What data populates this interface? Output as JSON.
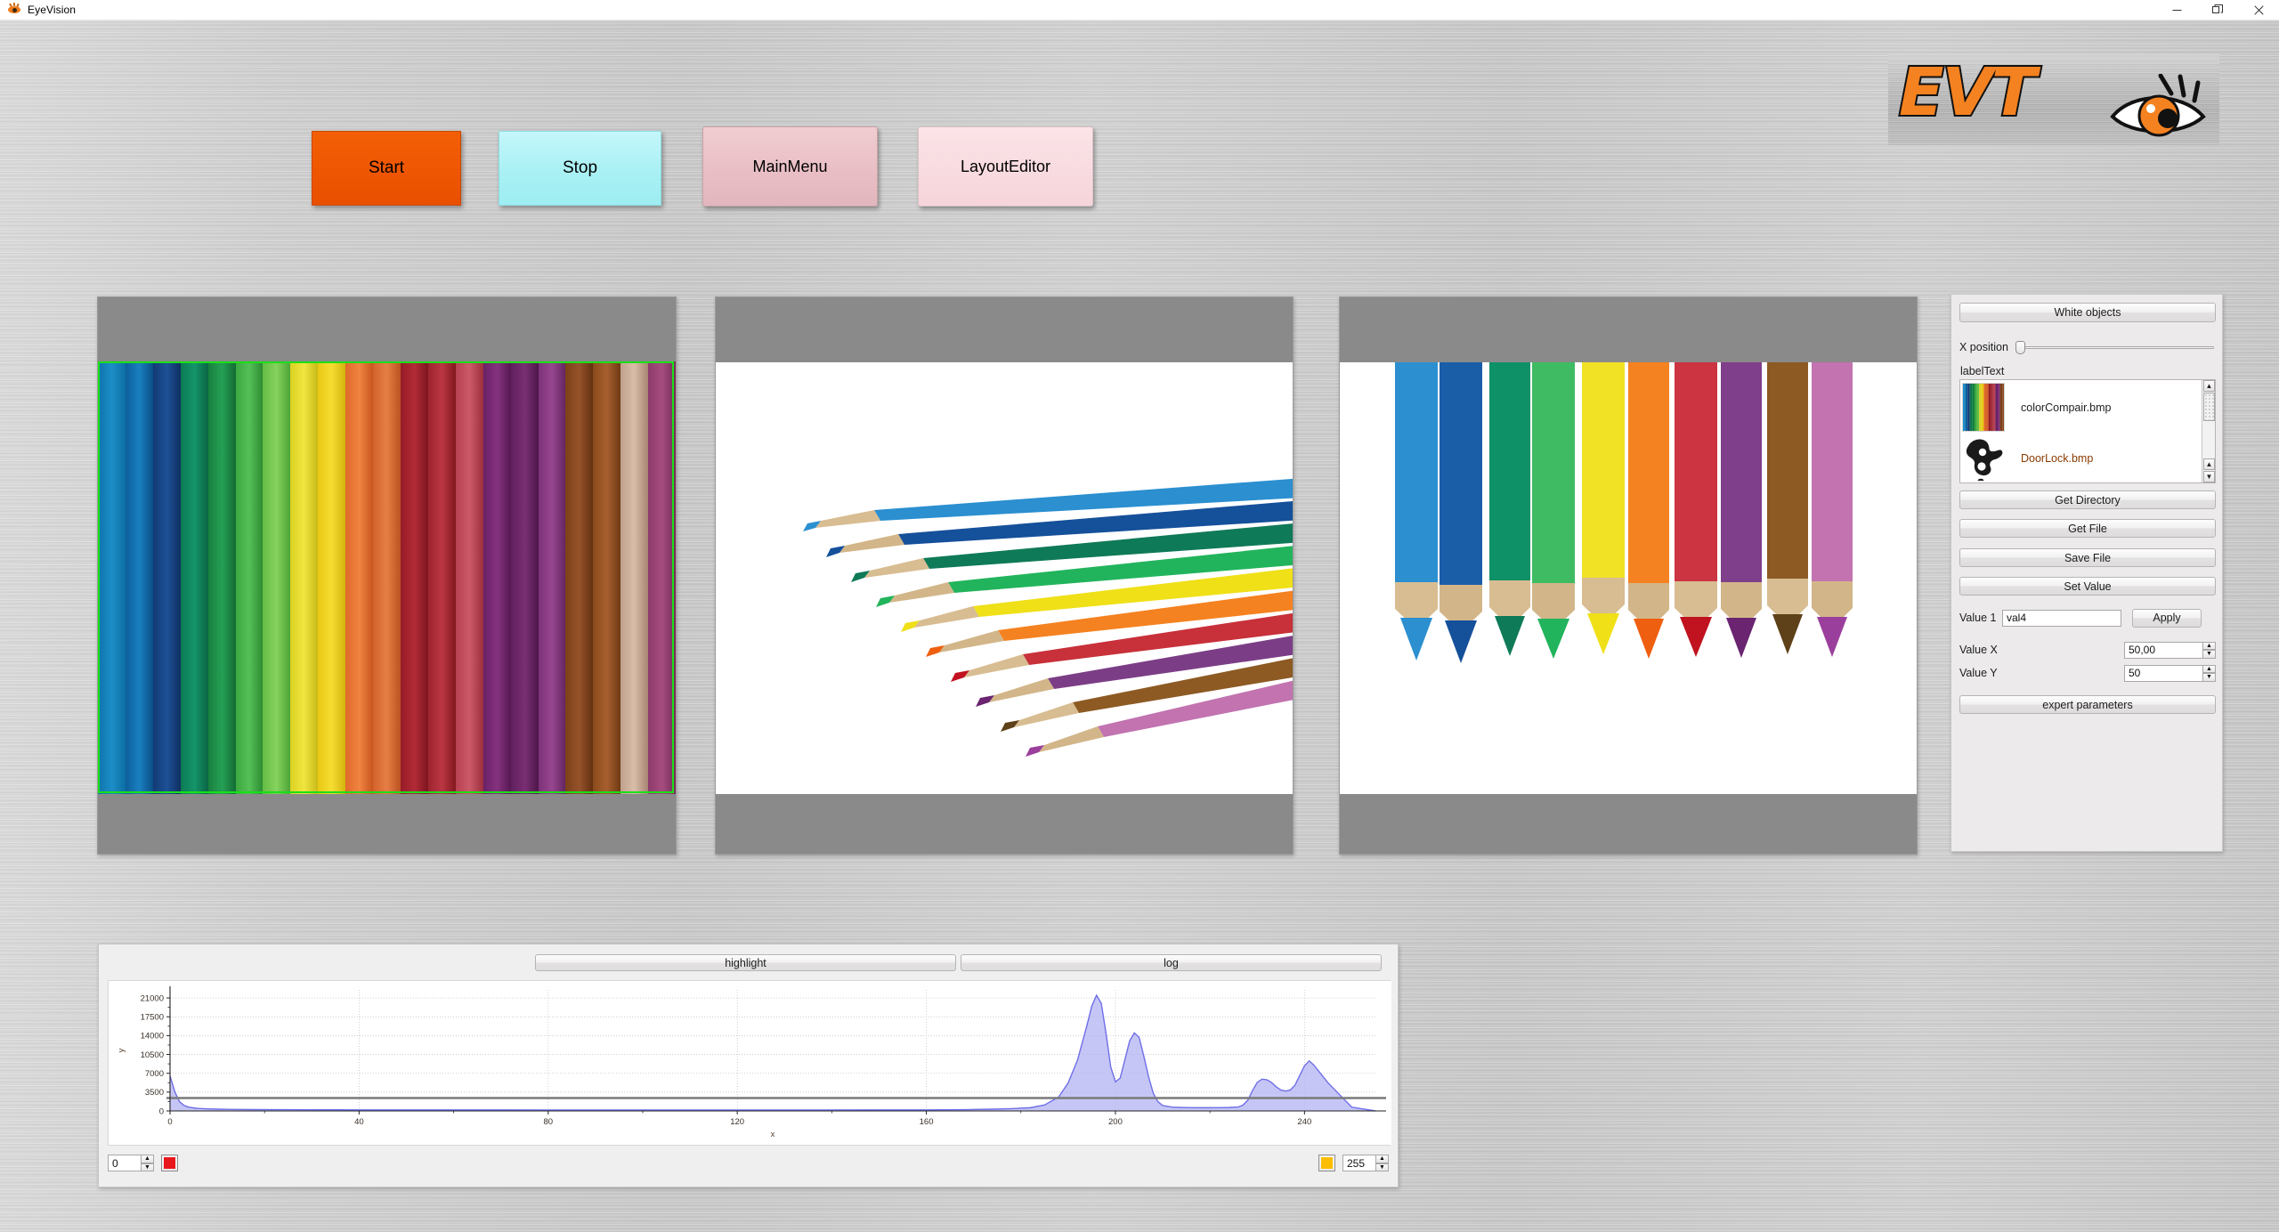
{
  "window": {
    "title": "EyeVision",
    "app_icon": "eye-icon",
    "controls": [
      {
        "name": "minimize",
        "glyph": "—"
      },
      {
        "name": "restore",
        "glyph": "❐"
      },
      {
        "name": "close",
        "glyph": "✕"
      }
    ]
  },
  "toolbar": {
    "start_label": "Start",
    "stop_label": "Stop",
    "mainmenu_label": "MainMenu",
    "layouteditor_label": "LayoutEditor",
    "start_color": "#ef5602",
    "stop_color": "#a9f0f4",
    "mainmenu_color": "#e9bfc5",
    "layouteditor_color": "#f8dbe0"
  },
  "logo": {
    "wordmark": "EVT",
    "icon": "eye-icon",
    "color": "#f58220",
    "outline": "#111111"
  },
  "image_panels": [
    {
      "name": "panel-colorcompair-closeup",
      "caption": "",
      "selection": true,
      "selection_color": "#19e019"
    },
    {
      "name": "panel-pencils-fanned",
      "caption": "",
      "selection": false
    },
    {
      "name": "panel-pencil-tips",
      "caption": "",
      "selection": false
    }
  ],
  "side_panel": {
    "white_objects_label": "White objects",
    "x_position_label": "X position",
    "x_position_value": 0,
    "label_text": "labelText",
    "list": {
      "items": [
        {
          "filename": "colorCompair.bmp",
          "selected": false,
          "thumb": "color-bands-thumb"
        },
        {
          "filename": "DoorLock.bmp",
          "selected": true,
          "thumb": "doorlock-silhouette-thumb"
        }
      ]
    },
    "buttons": {
      "get_directory": "Get Directory",
      "get_file": "Get File",
      "save_file": "Save File",
      "set_value": "Set Value",
      "apply": "Apply",
      "expert_parameters": "expert parameters"
    },
    "fields": {
      "value1_label": "Value 1",
      "value1_value": "val4",
      "valuex_label": "Value X",
      "valuex_value": "50,00",
      "valuey_label": "Value Y",
      "valuey_value": "50"
    }
  },
  "histogram": {
    "highlight_label": "highlight",
    "log_label": "log",
    "low_value": "0",
    "low_swatch_color": "#e8171c",
    "high_value": "255",
    "high_swatch_color": "#fbbe04"
  },
  "chart_data": {
    "type": "area",
    "title": "",
    "xlabel": "x",
    "ylabel": "y",
    "xlim": [
      0,
      255
    ],
    "ylim": [
      0,
      22500
    ],
    "xticks": [
      0,
      40,
      80,
      120,
      160,
      200,
      240
    ],
    "yticks": [
      0,
      3500,
      7000,
      10500,
      14000,
      17500,
      21000
    ],
    "grid": true,
    "legend": false,
    "series_color": "#6f6fe8",
    "fill_color": "#b0b0f2",
    "threshold_line": {
      "value": 2400,
      "color": "#7a7a7a"
    },
    "x": [
      0,
      1,
      2,
      3,
      4,
      5,
      6,
      8,
      10,
      14,
      18,
      24,
      30,
      40,
      50,
      60,
      70,
      80,
      90,
      100,
      110,
      120,
      130,
      140,
      150,
      160,
      168,
      174,
      178,
      182,
      185,
      188,
      190,
      192,
      194,
      195,
      196,
      197,
      198,
      199,
      200,
      201,
      202,
      203,
      204,
      205,
      206,
      207,
      208,
      209,
      210,
      212,
      214,
      216,
      218,
      220,
      222,
      224,
      226,
      227,
      228,
      229,
      230,
      231,
      232,
      233,
      234,
      235,
      236,
      237,
      238,
      239,
      240,
      241,
      242,
      245,
      250,
      255
    ],
    "y": [
      6500,
      3600,
      1700,
      1000,
      700,
      560,
      470,
      380,
      330,
      280,
      250,
      230,
      215,
      200,
      195,
      190,
      185,
      182,
      180,
      178,
      176,
      174,
      175,
      178,
      185,
      200,
      240,
      330,
      430,
      600,
      1100,
      2600,
      5200,
      9500,
      16000,
      19500,
      21500,
      20000,
      14500,
      8200,
      5400,
      6100,
      9500,
      13000,
      14500,
      13700,
      10200,
      6400,
      3300,
      1700,
      1000,
      720,
      640,
      610,
      600,
      600,
      610,
      640,
      740,
      1100,
      2000,
      3800,
      5300,
      5900,
      5800,
      5300,
      4500,
      3900,
      3700,
      3900,
      4800,
      6600,
      8400,
      9300,
      8500,
      5200,
      700,
      0,
      0
    ]
  }
}
